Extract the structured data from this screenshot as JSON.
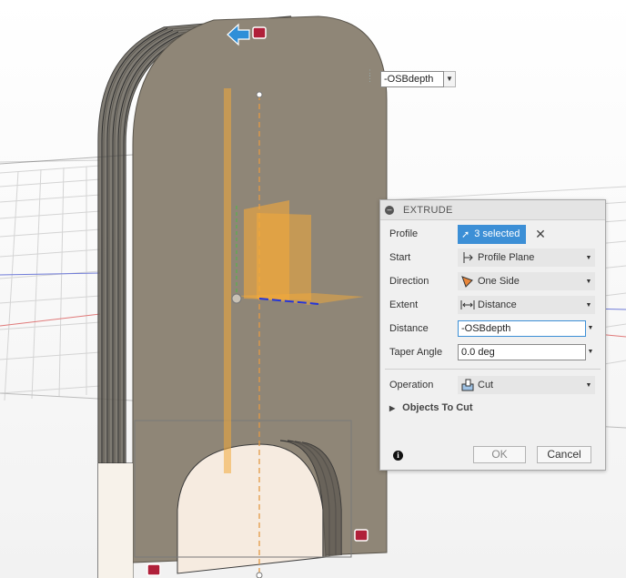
{
  "viewport": {
    "floating_value": "-OSBdepth"
  },
  "dialog": {
    "title": "EXTRUDE",
    "profile": {
      "label": "Profile",
      "value": "3 selected"
    },
    "start": {
      "label": "Start",
      "value": "Profile Plane"
    },
    "direction": {
      "label": "Direction",
      "value": "One Side"
    },
    "extent": {
      "label": "Extent",
      "value": "Distance"
    },
    "distance": {
      "label": "Distance",
      "value": "-OSBdepth"
    },
    "taper_angle": {
      "label": "Taper Angle",
      "value": "0.0 deg"
    },
    "operation": {
      "label": "Operation",
      "value": "Cut"
    },
    "objects_to_cut": "Objects To Cut",
    "ok_label": "OK",
    "cancel_label": "Cancel",
    "colors": {
      "accent": "#3c8fd6",
      "body": "#8f8677",
      "preview": "#f3a93a"
    }
  }
}
